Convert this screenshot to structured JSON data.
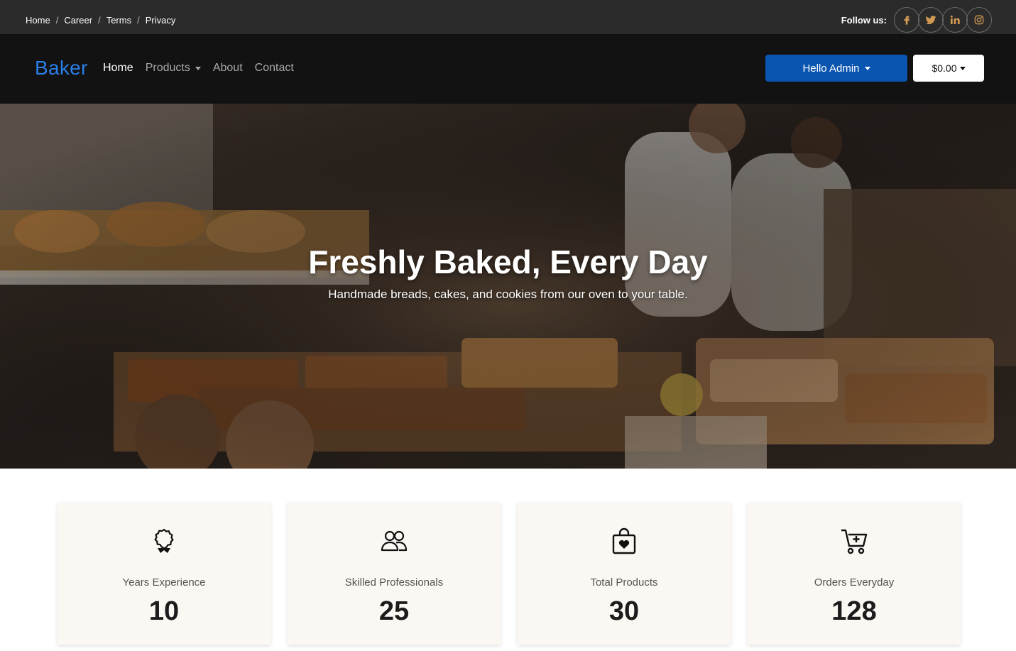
{
  "topbar": {
    "breadcrumbs": [
      "Home",
      "Career",
      "Terms",
      "Privacy"
    ],
    "follow_label": "Follow us:",
    "social_icons": [
      "facebook-icon",
      "twitter-icon",
      "linkedin-icon",
      "instagram-icon"
    ],
    "social_color": "#d39a53"
  },
  "navbar": {
    "brand": "Baker",
    "links": [
      "Home",
      "Products",
      "About",
      "Contact"
    ],
    "admin_button": "Hello Admin",
    "cart_button": "$0.00"
  },
  "hero": {
    "title": "Freshly Baked, Every Day",
    "subtitle": "Handmade breads, cakes, and cookies from our oven to your table."
  },
  "stats": [
    {
      "icon": "award-icon",
      "label": "Years Experience",
      "value": "10"
    },
    {
      "icon": "users-icon",
      "label": "Skilled Professionals",
      "value": "25"
    },
    {
      "icon": "shopping-bag-heart-icon",
      "label": "Total Products",
      "value": "30"
    },
    {
      "icon": "cart-plus-icon",
      "label": "Orders Everyday",
      "value": "128"
    }
  ],
  "colors": {
    "topbar": "#2b2b2b",
    "navbar": "#121212",
    "brand": "#2a7fe6",
    "primary_button": "#0a55b0",
    "card_background": "#fbf7f2"
  }
}
